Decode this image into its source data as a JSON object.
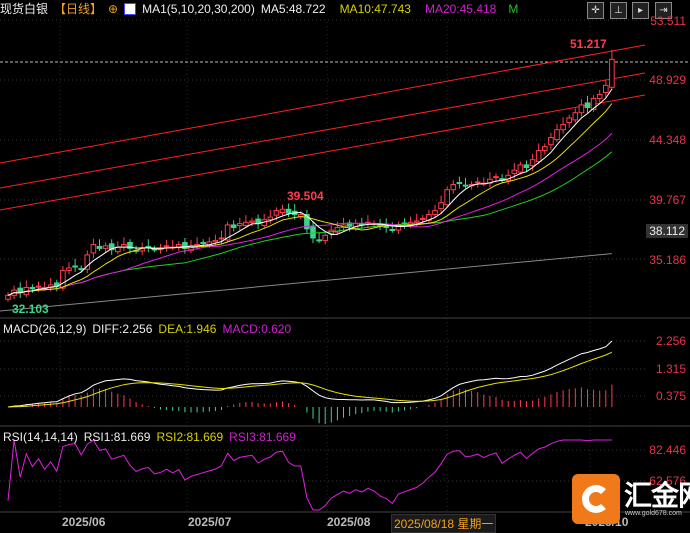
{
  "header": {
    "title": "现货白银",
    "period": "【日线】",
    "indicator": "MA1(5,10,20,30,200)",
    "ma5": "MA5:48.722",
    "ma10": "MA10:47.743",
    "ma20": "MA20:45.418",
    "more": "M"
  },
  "toolbar": {
    "icons": [
      "crosshair-icon",
      "zoom-range-icon",
      "step-icon",
      "exit-icon"
    ]
  },
  "price_axis": [
    "53.511",
    "48.929",
    "44.348",
    "39.767",
    "35.186"
  ],
  "current_price": "38.112",
  "annotations": {
    "high": "51.217",
    "mid_high": "39.504",
    "low": "32.103"
  },
  "macd": {
    "label": "MACD(26,12,9)",
    "diff": "DIFF:2.256",
    "dea": "DEA:1.946",
    "macd": "MACD:0.620",
    "axis": [
      "2.256",
      "1.315",
      "0.375"
    ]
  },
  "rsi": {
    "label": "RSI(14,14,14)",
    "rsi1": "RSI1:81.669",
    "rsi2": "RSI2:81.669",
    "rsi3": "RSI3:81.669",
    "axis": [
      "82.446",
      "62.576"
    ]
  },
  "x_axis": {
    "labels": [
      "2025/06",
      "2025/07",
      "2025/08",
      "2025/10"
    ],
    "cursor": "2025/08/18 星期一"
  },
  "logo": {
    "name": "汇金网",
    "url": "www.gold678.com"
  },
  "colors": {
    "up": "#ff3b4e",
    "down": "#3cd48a",
    "ma5": "#ffffff",
    "ma10": "#e8e000",
    "ma20": "#e020e0",
    "ma30": "#20d020",
    "ma200": "#888888",
    "axis": "#e8344a"
  },
  "chart_data": {
    "type": "candlestick",
    "title": "现货白银 日线",
    "ylim": [
      31.0,
      53.511
    ],
    "closes": [
      32.4,
      32.8,
      32.6,
      33.0,
      32.9,
      33.1,
      33.0,
      33.2,
      33.1,
      34.3,
      34.5,
      34.6,
      34.4,
      35.5,
      36.3,
      36.0,
      36.2,
      35.9,
      36.1,
      36.3,
      36.0,
      35.8,
      36.0,
      36.1,
      35.9,
      36.0,
      36.2,
      36.1,
      36.3,
      36.0,
      36.2,
      36.3,
      36.4,
      36.5,
      36.6,
      36.8,
      37.8,
      37.6,
      37.9,
      38.0,
      38.1,
      37.9,
      38.2,
      38.4,
      38.9,
      39.0,
      38.7,
      38.6,
      38.6,
      37.5,
      36.8,
      36.6,
      37.0,
      37.4,
      37.6,
      37.8,
      37.7,
      37.9,
      37.8,
      38.0,
      37.9,
      37.7,
      37.6,
      37.4,
      37.8,
      37.9,
      38.0,
      38.1,
      38.3,
      38.6,
      38.9,
      39.5,
      40.5,
      40.9,
      41.0,
      40.8,
      40.9,
      41.1,
      41.0,
      41.3,
      41.5,
      41.2,
      41.6,
      42.0,
      42.4,
      42.2,
      42.8,
      43.5,
      43.8,
      44.5,
      45.1,
      45.5,
      46.0,
      46.4,
      47.0,
      46.8,
      47.5,
      47.8,
      48.5,
      50.5
    ],
    "ma200_range": [
      31.2,
      35.6
    ]
  }
}
